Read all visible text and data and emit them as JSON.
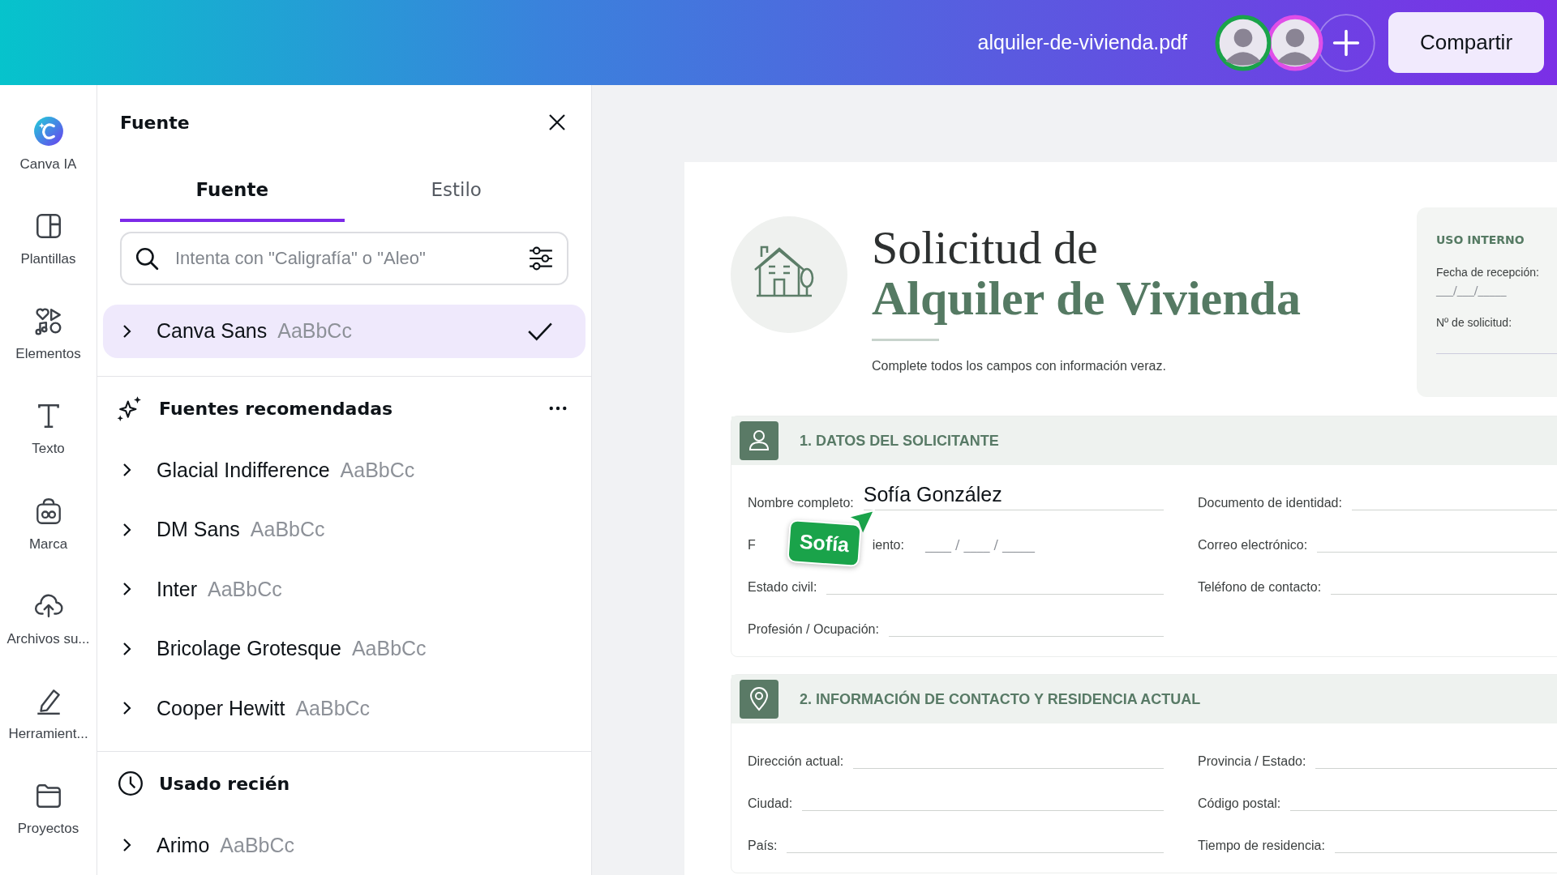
{
  "top_bar": {
    "file_name": "alquiler-de-vivienda.pdf",
    "collaborators": [
      {
        "color": "#1aa34a"
      },
      {
        "color": "#e04ee8"
      }
    ],
    "share_button": "Compartir"
  },
  "sidebar": {
    "items": [
      {
        "kind": "ai",
        "label": "Canva IA"
      },
      {
        "kind": "templates",
        "label": "Plantillas"
      },
      {
        "kind": "elements",
        "label": "Elementos"
      },
      {
        "kind": "text",
        "label": "Texto"
      },
      {
        "kind": "brand",
        "label": "Marca"
      },
      {
        "kind": "uploads",
        "label": "Archivos su..."
      },
      {
        "kind": "tools",
        "label": "Herramient..."
      },
      {
        "kind": "projects",
        "label": "Proyectos"
      }
    ]
  },
  "font_panel": {
    "title": "Fuente",
    "tabs": [
      {
        "label": "Fuente",
        "selected": true
      },
      {
        "label": "Estilo",
        "selected": false
      }
    ],
    "search": {
      "placeholder": "Intenta con \"Caligrafía\" o \"Aleo\""
    },
    "current_font": {
      "name": "Canva Sans",
      "sample": "AaBbCc",
      "selected": true
    },
    "recommended": {
      "title": "Fuentes recomendadas",
      "fonts": [
        {
          "name": "Glacial Indifference",
          "sample": "AaBbCc",
          "selected": false
        },
        {
          "name": "DM Sans",
          "sample": "AaBbCc",
          "selected": false
        },
        {
          "name": "Inter",
          "sample": "AaBbCc",
          "selected": false
        },
        {
          "name": "Bricolage Grotesque",
          "sample": "AaBbCc",
          "selected": false
        },
        {
          "name": "Cooper Hewitt",
          "sample": "AaBbCc",
          "selected": false
        }
      ]
    },
    "recent": {
      "title": "Usado recién",
      "fonts": [
        {
          "name": "Arimo",
          "sample": "AaBbCc",
          "selected": false
        }
      ]
    }
  },
  "document": {
    "title_line_1": "Solicitud de",
    "title_line_2": "Alquiler de Vivienda",
    "subtitle": "Complete todos los campos con información veraz.",
    "internal_use": {
      "title": "USO INTERNO",
      "received_label": "Fecha de recepción:",
      "received_blank": "___/___/_____",
      "number_label": "Nº de solicitud:"
    },
    "sections": [
      {
        "kind": "person",
        "title": "1. DATOS DEL SOLICITANTE",
        "rows": [
          [
            {
              "kind": "typed",
              "label": "Nombre completo:",
              "value": "Sofía González"
            },
            {
              "kind": "line",
              "label": "Documento de identidad:"
            }
          ],
          [
            {
              "kind": "covered_date",
              "label_parts": [
                "F",
                "iento:"
              ],
              "blank": "____ / ____ / _____"
            },
            {
              "kind": "line",
              "label": "Correo electrónico:"
            }
          ],
          [
            {
              "kind": "line",
              "label": "Estado civil:"
            },
            {
              "kind": "line",
              "label": "Teléfono de contacto:"
            }
          ],
          [
            {
              "kind": "line",
              "label": "Profesión / Ocupación:"
            }
          ]
        ]
      },
      {
        "kind": "location",
        "title": "2. INFORMACIÓN DE CONTACTO Y RESIDENCIA ACTUAL",
        "rows": [
          [
            {
              "kind": "line",
              "label": "Dirección actual:"
            },
            {
              "kind": "line",
              "label": "Provincia / Estado:"
            }
          ],
          [
            {
              "kind": "line",
              "label": "Ciudad:"
            },
            {
              "kind": "line",
              "label": "Código postal:"
            }
          ],
          [
            {
              "kind": "line",
              "label": "País:"
            },
            {
              "kind": "line",
              "label": "Tiempo de residencia:"
            }
          ]
        ]
      }
    ],
    "collaborator_cursor": {
      "name": "Sofía",
      "color": "#1aa34a"
    }
  }
}
